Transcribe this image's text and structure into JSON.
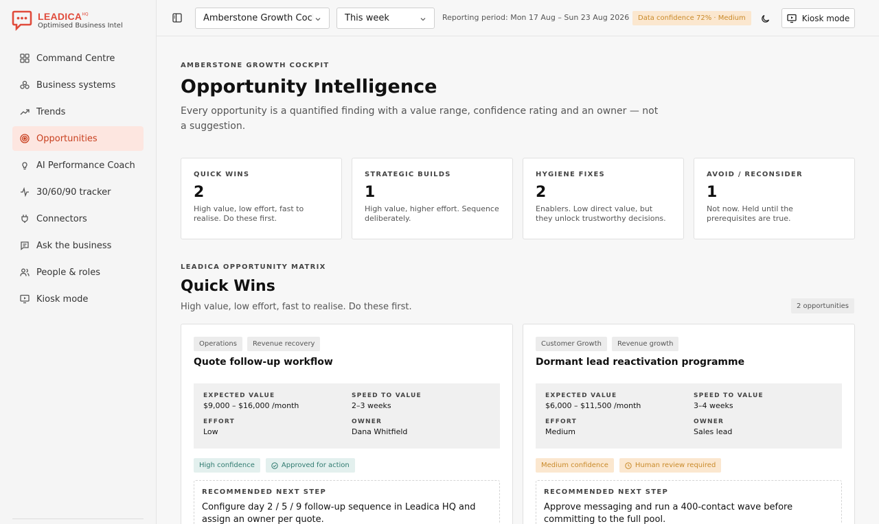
{
  "brand": {
    "name": "LEADICA",
    "mark": "HQ",
    "tagline": "Optimised Business Intel"
  },
  "nav": {
    "items": [
      {
        "label": "Command Centre",
        "icon": "grid-icon"
      },
      {
        "label": "Business systems",
        "icon": "systems-icon"
      },
      {
        "label": "Trends",
        "icon": "trend-icon"
      },
      {
        "label": "Opportunities",
        "icon": "target-icon",
        "active": true
      },
      {
        "label": "AI Performance Coach",
        "icon": "lightbulb-icon"
      },
      {
        "label": "30/60/90 tracker",
        "icon": "pulse-icon"
      },
      {
        "label": "Connectors",
        "icon": "plug-icon"
      },
      {
        "label": "Ask the business",
        "icon": "chat-icon"
      },
      {
        "label": "People & roles",
        "icon": "people-icon"
      },
      {
        "label": "Kiosk mode",
        "icon": "monitor-icon"
      }
    ]
  },
  "topbar": {
    "workspace": "Amberstone Growth Cockpit",
    "period": "This week",
    "reporting_period": "Reporting period: Mon 17 Aug – Sun 23 Aug 2026",
    "confidence": "Data confidence 72% · Medium",
    "kiosk_label": "Kiosk mode"
  },
  "header": {
    "eyebrow": "AMBERSTONE GROWTH COCKPIT",
    "title": "Opportunity Intelligence",
    "subtitle": "Every opportunity is a quantified finding with a value range, confidence rating and an owner — not a suggestion."
  },
  "stats": [
    {
      "label": "QUICK WINS",
      "value": "2",
      "desc": "High value, low effort, fast to realise. Do these first."
    },
    {
      "label": "STRATEGIC BUILDS",
      "value": "1",
      "desc": "High value, higher effort. Sequence deliberately."
    },
    {
      "label": "HYGIENE FIXES",
      "value": "2",
      "desc": "Enablers. Low direct value, but they unlock trustworthy decisions."
    },
    {
      "label": "AVOID / RECONSIDER",
      "value": "1",
      "desc": "Not now. Held until the prerequisites are true."
    }
  ],
  "section": {
    "eyebrow": "LEADICA OPPORTUNITY MATRIX",
    "title": "Quick Wins",
    "subtitle": "High value, low effort, fast to realise. Do these first.",
    "count": "2 opportunities"
  },
  "labels": {
    "expected_value": "EXPECTED VALUE",
    "speed_to_value": "SPEED TO VALUE",
    "effort": "EFFORT",
    "owner": "OWNER",
    "next_step": "RECOMMENDED NEXT STEP"
  },
  "cards": [
    {
      "tags": [
        "Operations",
        "Revenue recovery"
      ],
      "title": "Quote follow-up workflow",
      "expected_value": "$9,000 – $16,000 /month",
      "speed": "2–3 weeks",
      "effort": "Low",
      "owner": "Dana Whitfield",
      "confidence": "High confidence",
      "status": "Approved for action",
      "next_step": "Configure day 2 / 5 / 9 follow-up sequence in Leadica HQ and assign an owner per quote."
    },
    {
      "tags": [
        "Customer Growth",
        "Revenue growth"
      ],
      "title": "Dormant lead reactivation programme",
      "expected_value": "$6,000 – $11,500 /month",
      "speed": "3–4 weeks",
      "effort": "Medium",
      "owner": "Sales lead",
      "confidence": "Medium confidence",
      "status": "Human review required",
      "next_step": "Approve messaging and run a 400-contact wave before committing to the full pool."
    }
  ]
}
